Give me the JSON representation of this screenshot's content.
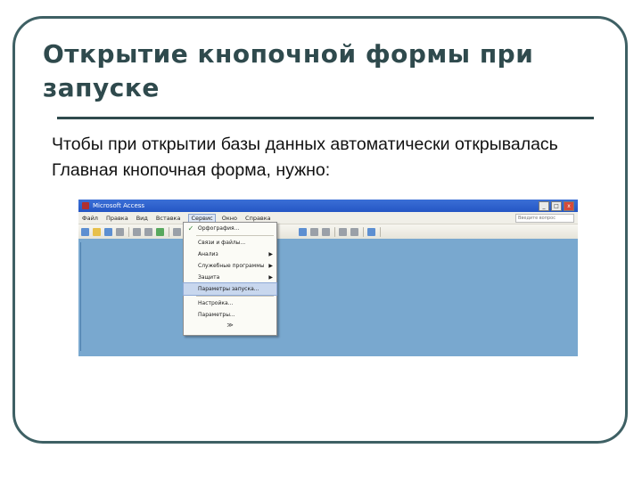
{
  "slide": {
    "title": "Открытие кнопочной формы при запуске",
    "body": "Чтобы при открытии базы данных автоматически открывалась Главная кнопочная форма, нужно:"
  },
  "window": {
    "title": "Microsoft Access",
    "controls": [
      "_",
      "□",
      "x"
    ]
  },
  "menu": {
    "items": [
      "Файл",
      "Правка",
      "Вид",
      "Вставка",
      "Сервис",
      "Окно",
      "Справка"
    ],
    "active_index": 4,
    "search_placeholder": "Введите вопрос"
  },
  "dropdown": {
    "items": [
      {
        "label": "Орфография...",
        "icon": "spellcheck-icon",
        "submenu": false
      },
      {
        "label": "Связи и файлы...",
        "icon": "",
        "submenu": false
      },
      {
        "label": "Анализ",
        "icon": "",
        "submenu": true
      },
      {
        "label": "Служебные программы",
        "icon": "",
        "submenu": true
      },
      {
        "label": "Защита",
        "icon": "",
        "submenu": true
      },
      {
        "label": "Параметры запуска...",
        "icon": "",
        "submenu": false,
        "highlighted": true
      },
      {
        "label": "Настройка...",
        "icon": "",
        "submenu": false
      },
      {
        "label": "Параметры...",
        "icon": "",
        "submenu": false
      }
    ],
    "more": "≫"
  }
}
